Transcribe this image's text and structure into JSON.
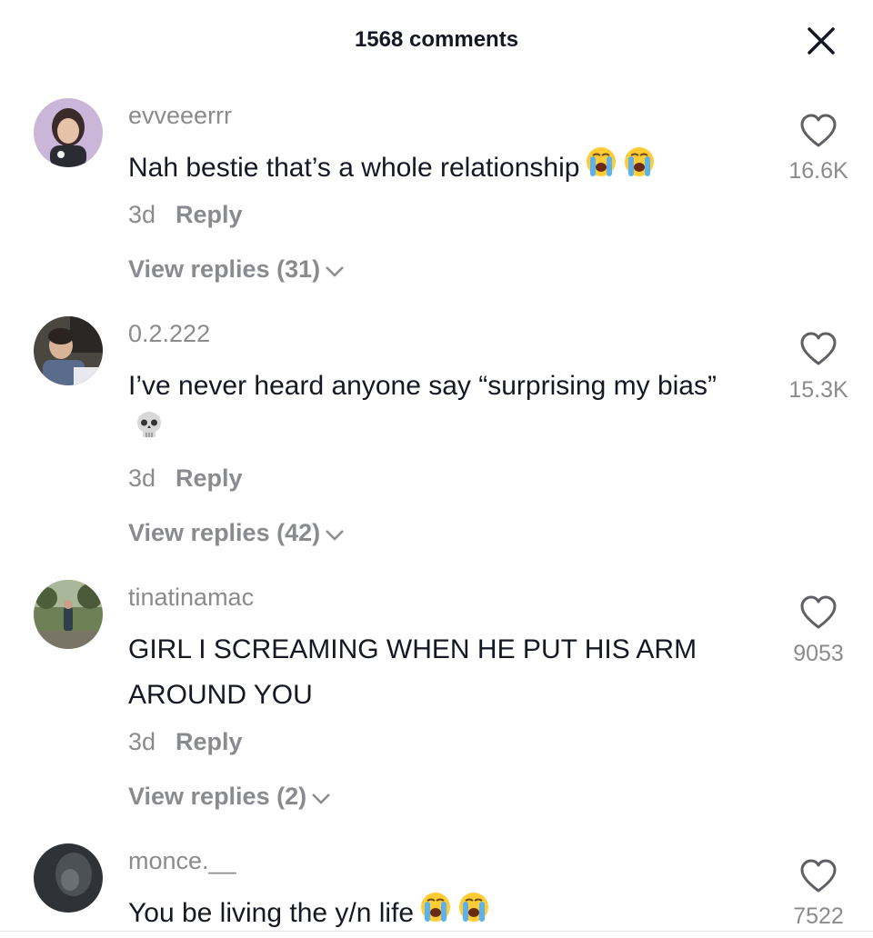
{
  "header": {
    "title": "1568 comments",
    "close_icon": "close-icon"
  },
  "comments": [
    {
      "username": "evveeerrr",
      "text": "Nah bestie that’s a whole relationship",
      "emojis": [
        "loudly-crying-face",
        "loudly-crying-face"
      ],
      "time": "3d",
      "reply_label": "Reply",
      "view_replies": "View replies (31)",
      "likes": "16.6K"
    },
    {
      "username": "0.2.222",
      "text": "I’ve never heard anyone say “surprising my bias”",
      "emojis": [
        "skull"
      ],
      "time": "3d",
      "reply_label": "Reply",
      "view_replies": "View replies (42)",
      "likes": "15.3K"
    },
    {
      "username": "tinatinamac",
      "text": "GIRL I SCREAMING WHEN HE PUT HIS ARM AROUND YOU",
      "emojis": [],
      "time": "3d",
      "reply_label": "Reply",
      "view_replies": "View replies (2)",
      "likes": "9053"
    },
    {
      "username": "monce.__",
      "text": "You be living the y/n life",
      "emojis": [
        "loudly-crying-face",
        "loudly-crying-face"
      ],
      "time": "",
      "reply_label": "",
      "view_replies": "",
      "likes": "7522"
    }
  ],
  "colors": {
    "primary_text": "#161823",
    "secondary_text": "#8a8b91",
    "background": "#ffffff"
  }
}
